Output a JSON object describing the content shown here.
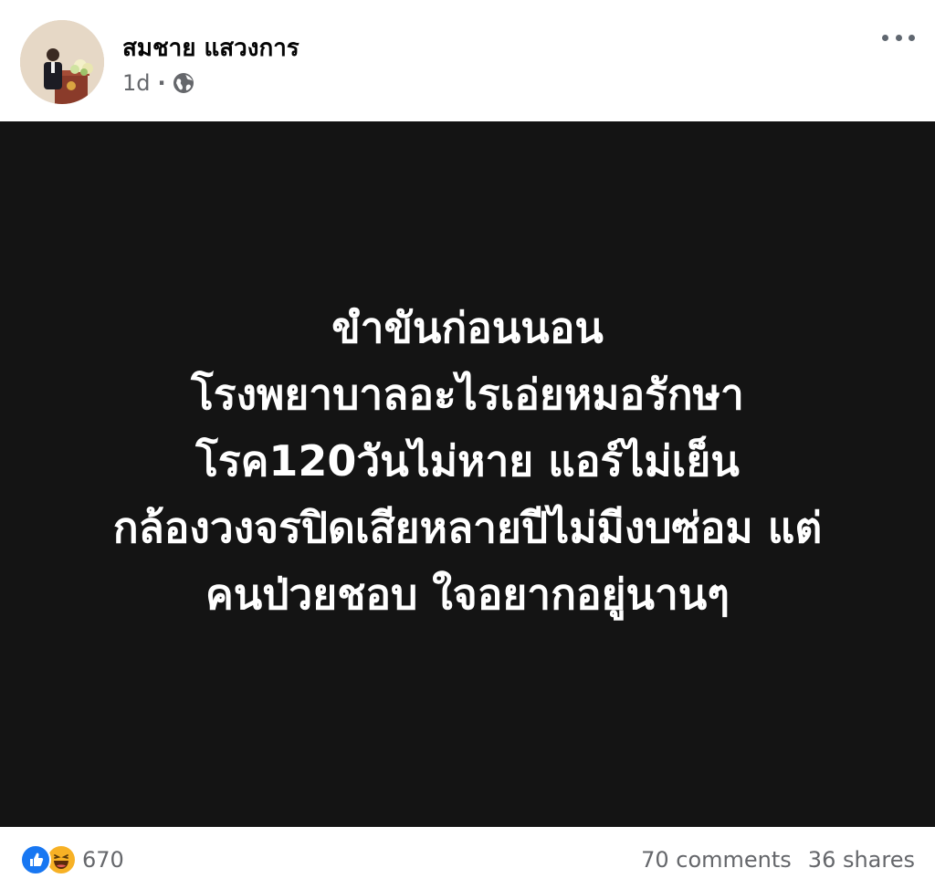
{
  "post": {
    "author": "สมชาย แสวงการ",
    "time": "1d",
    "separator": "·",
    "image_text": [
      "ขำขันก่อนนอน",
      "โรงพยาบาลอะไรเอ่ยหมอรักษา",
      "โรค120วันไม่หาย แอร์ไม่เย็น",
      "กล้องวงจรปิดเสียหลายปีไม่มีงบซ่อม แต่",
      "คนป่วยชอบ ใจอยากอยู่นานๆ"
    ],
    "reaction_count": "670",
    "comments": "70 comments",
    "shares": "36 shares"
  },
  "icons": {
    "privacy": "globe-icon",
    "more": "more-options-icon",
    "reactions": [
      "like-icon",
      "haha-icon"
    ]
  },
  "colors": {
    "image_background": "#141414",
    "text_primary": "#050505",
    "text_secondary": "#65676b",
    "like_blue": "#1877f2",
    "haha_yellow": "#f7b125"
  }
}
